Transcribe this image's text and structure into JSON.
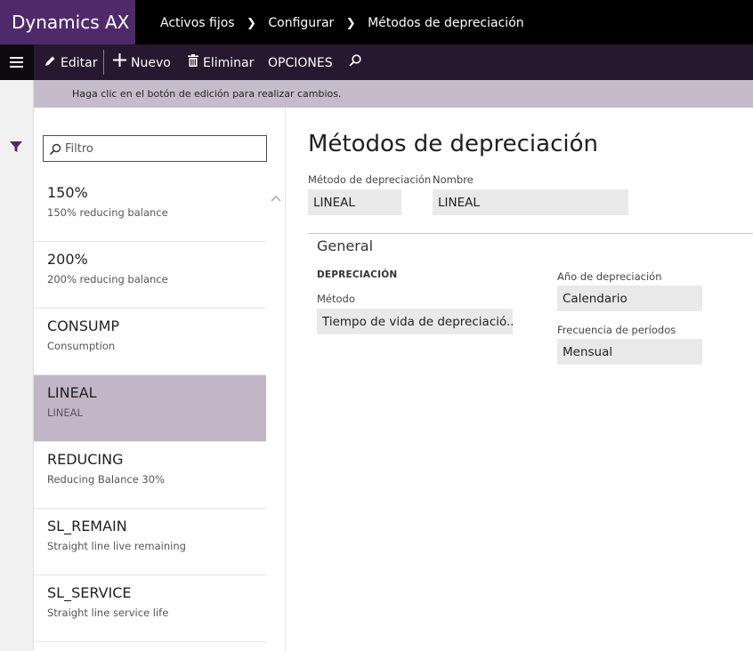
{
  "app": {
    "brand": "Dynamics AX"
  },
  "breadcrumb": [
    "Activos fijos",
    "Configurar",
    "Métodos de depreciación"
  ],
  "toolbar": {
    "edit_label": "Editar",
    "new_label": "Nuevo",
    "delete_label": "Eliminar",
    "options_label": "OPCIONES"
  },
  "message": "Haga clic en el botón de edición para realizar cambios.",
  "filter": {
    "placeholder": "Filtro"
  },
  "list": {
    "items": [
      {
        "code": "150%",
        "desc": "150% reducing balance",
        "selected": false
      },
      {
        "code": "200%",
        "desc": "200% reducing balance",
        "selected": false
      },
      {
        "code": "CONSUMP",
        "desc": "Consumption",
        "selected": false
      },
      {
        "code": "LINEAL",
        "desc": "LINEAL",
        "selected": true
      },
      {
        "code": "REDUCING",
        "desc": "Reducing Balance 30%",
        "selected": false
      },
      {
        "code": "SL_REMAIN",
        "desc": "Straight line live remaining",
        "selected": false
      },
      {
        "code": "SL_SERVICE",
        "desc": "Straight line service life",
        "selected": false
      }
    ]
  },
  "detail": {
    "title": "Métodos de depreciación",
    "method_label": "Método de depreciación",
    "method_value": "LINEAL",
    "name_label": "Nombre",
    "name_value": "LINEAL",
    "general_section": "General",
    "depreciation_heading": "DEPRECIACIÓN",
    "metodo_label": "Método",
    "metodo_value": "Tiempo de vida de depreciació...",
    "year_label": "Año de depreciación",
    "year_value": "Calendario",
    "freq_label": "Frecuencia de períodos",
    "freq_value": "Mensual"
  },
  "colors": {
    "brand_bg": "#4f2a6b",
    "actionbar_bg": "#26182f",
    "message_bg": "#c5bccb",
    "selected_bg": "#c1b6c8",
    "filter_icon": "#4f2a6b"
  },
  "icons": [
    "menu-icon",
    "edit-icon",
    "add-icon",
    "delete-icon",
    "search-icon",
    "filter-icon",
    "chevron-up-icon"
  ]
}
